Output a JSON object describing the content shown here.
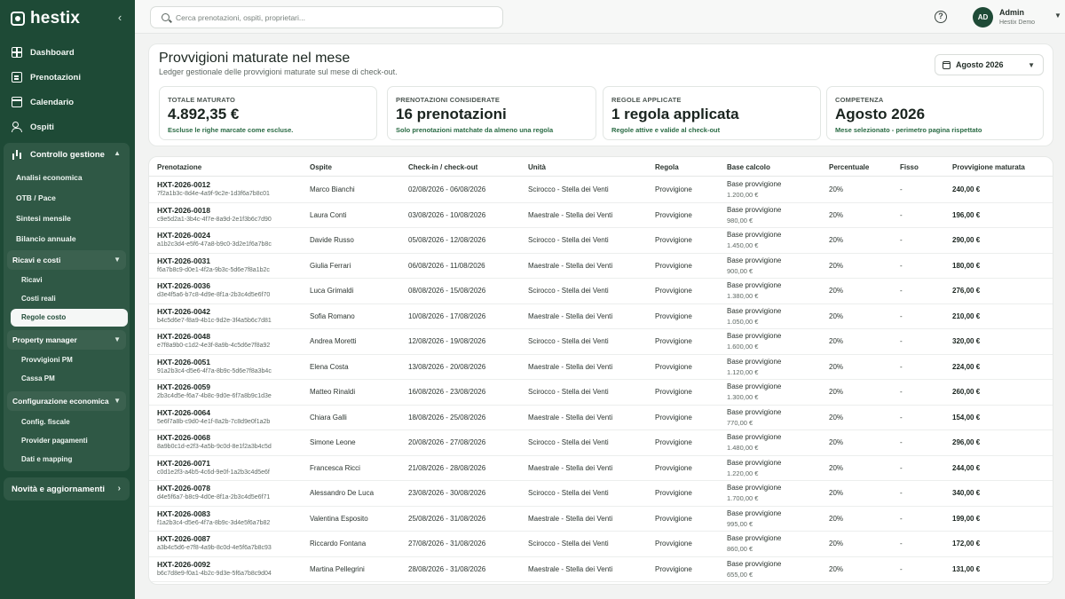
{
  "brand": {
    "name": "hestix"
  },
  "sidebar": {
    "collapse": "‹",
    "main": [
      {
        "label": "Dashboard",
        "icon": "grid-icon"
      },
      {
        "label": "Prenotazioni",
        "icon": "book-icon"
      },
      {
        "label": "Calendario",
        "icon": "calendar-icon"
      },
      {
        "label": "Ospiti",
        "icon": "users-icon"
      }
    ],
    "controllo": {
      "label": "Controllo gestione",
      "items": [
        "Analisi economica",
        "OTB / Pace",
        "Sintesi mensile",
        "Bilancio annuale"
      ],
      "ricavi": {
        "label": "Ricavi e costi",
        "items": [
          "Ricavi",
          "Costi reali",
          "Regole costo"
        ]
      },
      "pm": {
        "label": "Property manager",
        "items": [
          "Provvigioni PM",
          "Cassa PM"
        ]
      },
      "config": {
        "label": "Configurazione economica",
        "items": [
          "Config. fiscale",
          "Provider pagamenti",
          "Dati e mapping"
        ]
      }
    },
    "news": "Novità e aggiornamenti"
  },
  "topbar": {
    "search_placeholder": "Cerca prenotazioni, ospiti, proprietari...",
    "help": "?",
    "avatar": "AD",
    "user_name": "Admin",
    "user_org": "Hestix Demo"
  },
  "header": {
    "title": "Provvigioni maturate nel mese",
    "subtitle": "Ledger gestionale delle provvigioni maturate sul mese di check-out.",
    "month": "Agosto 2026"
  },
  "kpis": [
    {
      "label": "TOTALE MATURATO",
      "value": "4.892,35 €",
      "note": "Escluse le righe marcate come escluse."
    },
    {
      "label": "PRENOTAZIONI CONSIDERATE",
      "value": "16 prenotazioni",
      "note": "Solo prenotazioni matchate da almeno una regola"
    },
    {
      "label": "REGOLE APPLICATE",
      "value": "1 regola applicata",
      "note": "Regole attive e valide al check-out"
    },
    {
      "label": "COMPETENZA",
      "value": "Agosto 2026",
      "note": "Mese selezionato - perimetro pagina rispettato"
    }
  ],
  "table": {
    "headers": [
      "Prenotazione",
      "Ospite",
      "Check-in / check-out",
      "Unità",
      "Regola",
      "Base calcolo",
      "Percentuale",
      "Fisso",
      "Provvigione maturata"
    ],
    "base_label": "Base provvigione",
    "rows": [
      {
        "code": "HXT-2026-0012",
        "hash": "7f2a1b3c-8d4e-4a9f-9c2e-1d3f6a7b8c01",
        "guest": "Marco Bianchi",
        "dates": "02/08/2026 - 06/08/2026",
        "unit": "Scirocco - Stella dei Venti",
        "rule": "Provvigione",
        "base": "1.200,00 €",
        "pct": "20%",
        "fixed": "-",
        "amount": "240,00 €"
      },
      {
        "code": "HXT-2026-0018",
        "hash": "c9e5d2a1-3b4c-4f7e-8a9d-2e1f3b6c7d90",
        "guest": "Laura Conti",
        "dates": "03/08/2026 - 10/08/2026",
        "unit": "Maestrale - Stella dei Venti",
        "rule": "Provvigione",
        "base": "980,00 €",
        "pct": "20%",
        "fixed": "-",
        "amount": "196,00 €"
      },
      {
        "code": "HXT-2026-0024",
        "hash": "a1b2c3d4-e5f6-47a8-b9c0-3d2e1f6a7b8c",
        "guest": "Davide Russo",
        "dates": "05/08/2026 - 12/08/2026",
        "unit": "Scirocco - Stella dei Venti",
        "rule": "Provvigione",
        "base": "1.450,00 €",
        "pct": "20%",
        "fixed": "-",
        "amount": "290,00 €"
      },
      {
        "code": "HXT-2026-0031",
        "hash": "f6a7b8c9-d0e1-4f2a-9b3c-5d6e7f8a1b2c",
        "guest": "Giulia Ferrari",
        "dates": "06/08/2026 - 11/08/2026",
        "unit": "Maestrale - Stella dei Venti",
        "rule": "Provvigione",
        "base": "900,00 €",
        "pct": "20%",
        "fixed": "-",
        "amount": "180,00 €"
      },
      {
        "code": "HXT-2026-0036",
        "hash": "d3e4f5a6-b7c8-4d9e-8f1a-2b3c4d5e6f70",
        "guest": "Luca Grimaldi",
        "dates": "08/08/2026 - 15/08/2026",
        "unit": "Scirocco - Stella dei Venti",
        "rule": "Provvigione",
        "base": "1.380,00 €",
        "pct": "20%",
        "fixed": "-",
        "amount": "276,00 €"
      },
      {
        "code": "HXT-2026-0042",
        "hash": "b4c5d6e7-f8a9-4b1c-9d2e-3f4a5b6c7d81",
        "guest": "Sofia Romano",
        "dates": "10/08/2026 - 17/08/2026",
        "unit": "Maestrale - Stella dei Venti",
        "rule": "Provvigione",
        "base": "1.050,00 €",
        "pct": "20%",
        "fixed": "-",
        "amount": "210,00 €"
      },
      {
        "code": "HXT-2026-0048",
        "hash": "e7f8a9b0-c1d2-4e3f-8a9b-4c5d6e7f8a92",
        "guest": "Andrea Moretti",
        "dates": "12/08/2026 - 19/08/2026",
        "unit": "Scirocco - Stella dei Venti",
        "rule": "Provvigione",
        "base": "1.600,00 €",
        "pct": "20%",
        "fixed": "-",
        "amount": "320,00 €"
      },
      {
        "code": "HXT-2026-0051",
        "hash": "91a2b3c4-d5e6-4f7a-8b9c-5d6e7f8a3b4c",
        "guest": "Elena Costa",
        "dates": "13/08/2026 - 20/08/2026",
        "unit": "Maestrale - Stella dei Venti",
        "rule": "Provvigione",
        "base": "1.120,00 €",
        "pct": "20%",
        "fixed": "-",
        "amount": "224,00 €"
      },
      {
        "code": "HXT-2026-0059",
        "hash": "2b3c4d5e-f6a7-4b8c-9d0e-6f7a8b9c1d3e",
        "guest": "Matteo Rinaldi",
        "dates": "16/08/2026 - 23/08/2026",
        "unit": "Scirocco - Stella dei Venti",
        "rule": "Provvigione",
        "base": "1.300,00 €",
        "pct": "20%",
        "fixed": "-",
        "amount": "260,00 €"
      },
      {
        "code": "HXT-2026-0064",
        "hash": "5e6f7a8b-c9d0-4e1f-8a2b-7c8d9e0f1a2b",
        "guest": "Chiara Galli",
        "dates": "18/08/2026 - 25/08/2026",
        "unit": "Maestrale - Stella dei Venti",
        "rule": "Provvigione",
        "base": "770,00 €",
        "pct": "20%",
        "fixed": "-",
        "amount": "154,00 €"
      },
      {
        "code": "HXT-2026-0068",
        "hash": "8a9b0c1d-e2f3-4a5b-9c0d-8e1f2a3b4c5d",
        "guest": "Simone Leone",
        "dates": "20/08/2026 - 27/08/2026",
        "unit": "Scirocco - Stella dei Venti",
        "rule": "Provvigione",
        "base": "1.480,00 €",
        "pct": "20%",
        "fixed": "-",
        "amount": "296,00 €"
      },
      {
        "code": "HXT-2026-0071",
        "hash": "c0d1e2f3-a4b5-4c6d-9e0f-1a2b3c4d5e6f",
        "guest": "Francesca Ricci",
        "dates": "21/08/2026 - 28/08/2026",
        "unit": "Maestrale - Stella dei Venti",
        "rule": "Provvigione",
        "base": "1.220,00 €",
        "pct": "20%",
        "fixed": "-",
        "amount": "244,00 €"
      },
      {
        "code": "HXT-2026-0078",
        "hash": "d4e5f6a7-b8c9-4d0e-8f1a-2b3c4d5e6f71",
        "guest": "Alessandro De Luca",
        "dates": "23/08/2026 - 30/08/2026",
        "unit": "Scirocco - Stella dei Venti",
        "rule": "Provvigione",
        "base": "1.700,00 €",
        "pct": "20%",
        "fixed": "-",
        "amount": "340,00 €"
      },
      {
        "code": "HXT-2026-0083",
        "hash": "f1a2b3c4-d5e6-4f7a-8b9c-3d4e5f6a7b82",
        "guest": "Valentina Esposito",
        "dates": "25/08/2026 - 31/08/2026",
        "unit": "Maestrale - Stella dei Venti",
        "rule": "Provvigione",
        "base": "995,00 €",
        "pct": "20%",
        "fixed": "-",
        "amount": "199,00 €"
      },
      {
        "code": "HXT-2026-0087",
        "hash": "a3b4c5d6-e7f8-4a9b-8c0d-4e5f6a7b8c93",
        "guest": "Riccardo Fontana",
        "dates": "27/08/2026 - 31/08/2026",
        "unit": "Scirocco - Stella dei Venti",
        "rule": "Provvigione",
        "base": "860,00 €",
        "pct": "20%",
        "fixed": "-",
        "amount": "172,00 €"
      },
      {
        "code": "HXT-2026-0092",
        "hash": "b6c7d8e9-f0a1-4b2c-9d3e-5f6a7b8c9d04",
        "guest": "Martina Pellegrini",
        "dates": "28/08/2026 - 31/08/2026",
        "unit": "Maestrale - Stella dei Venti",
        "rule": "Provvigione",
        "base": "655,00 €",
        "pct": "20%",
        "fixed": "-",
        "amount": "131,00 €"
      }
    ]
  },
  "colors": {
    "sidebar": "#1e4a36",
    "accent_text": "#2a6b44",
    "background": "#f2f3f2"
  }
}
